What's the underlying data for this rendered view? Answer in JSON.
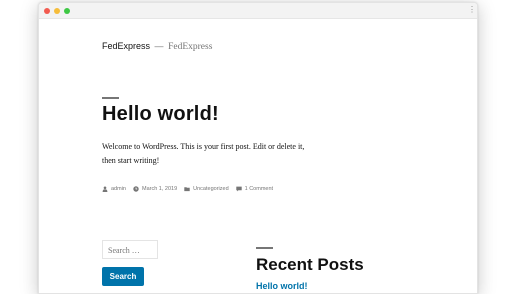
{
  "site": {
    "title": "FedExpress",
    "separator": "—",
    "tagline": "FedExpress"
  },
  "post": {
    "title": "Hello world!",
    "content": "Welcome to WordPress. This is your first post. Edit or delete it, then start writing!",
    "meta": {
      "author": "admin",
      "date": "March 1, 2019",
      "category": "Uncategorized",
      "comments": "1 Comment"
    }
  },
  "sidebar": {
    "search_placeholder": "Search …",
    "search_button": "Search",
    "recent_posts_title": "Recent Posts",
    "recent_posts": [
      "Hello world!"
    ]
  },
  "colors": {
    "link": "#0073aa",
    "text": "#111111",
    "meta": "#767676"
  }
}
